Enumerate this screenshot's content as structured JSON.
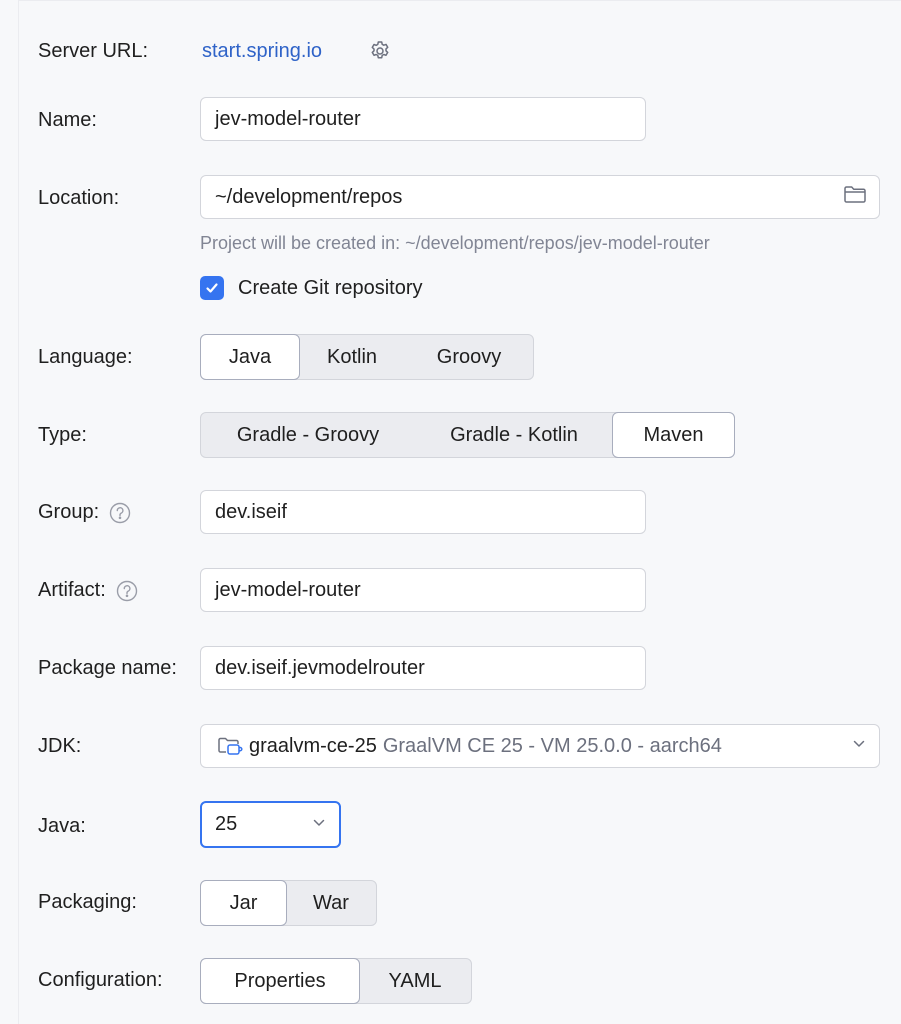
{
  "server": {
    "label": "Server URL:",
    "url": "start.spring.io"
  },
  "name": {
    "label": "Name:",
    "value": "jev-model-router"
  },
  "location": {
    "label": "Location:",
    "value": "~/development/repos",
    "hint": "Project will be created in: ~/development/repos/jev-model-router"
  },
  "git": {
    "label": "Create Git repository",
    "checked": true
  },
  "language": {
    "label": "Language:",
    "options": [
      "Java",
      "Kotlin",
      "Groovy"
    ],
    "selected": "Java"
  },
  "type": {
    "label": "Type:",
    "options": [
      "Gradle - Groovy",
      "Gradle - Kotlin",
      "Maven"
    ],
    "selected": "Maven"
  },
  "group": {
    "label": "Group:",
    "value": "dev.iseif"
  },
  "artifact": {
    "label": "Artifact:",
    "value": "jev-model-router"
  },
  "package_name": {
    "label": "Package name:",
    "value": "dev.iseif.jevmodelrouter"
  },
  "jdk": {
    "label": "JDK:",
    "name": "graalvm-ce-25",
    "description": "GraalVM CE 25 - VM 25.0.0 - aarch64"
  },
  "java": {
    "label": "Java:",
    "value": "25"
  },
  "packaging": {
    "label": "Packaging:",
    "options": [
      "Jar",
      "War"
    ],
    "selected": "Jar"
  },
  "configuration": {
    "label": "Configuration:",
    "options": [
      "Properties",
      "YAML"
    ],
    "selected": "Properties"
  },
  "colors": {
    "accent": "#3574f0",
    "link": "#2f63c8",
    "hint": "#818594",
    "background": "#f7f8fa"
  }
}
